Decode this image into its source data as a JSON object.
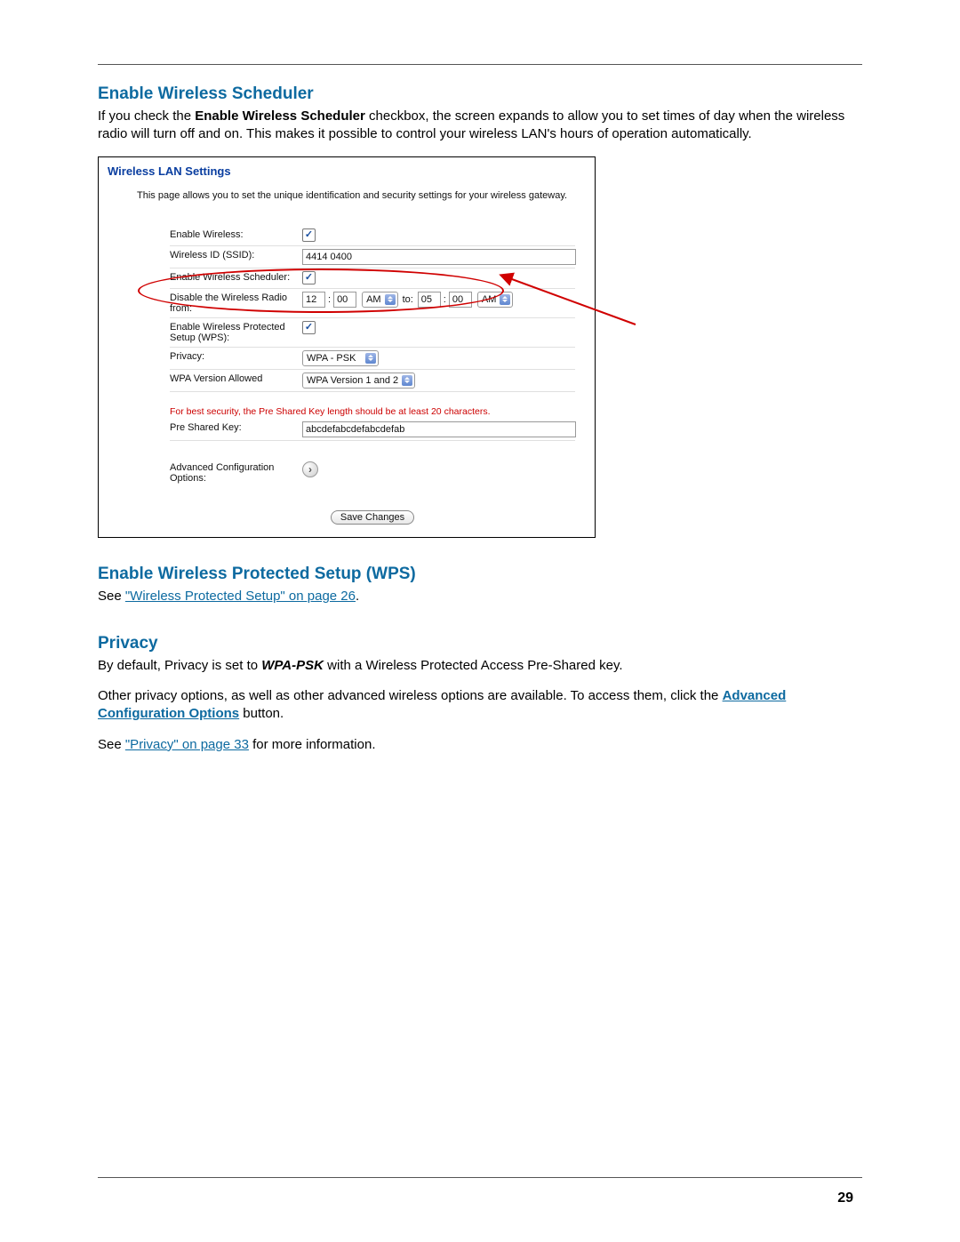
{
  "page_number": "29",
  "sections": {
    "scheduler": {
      "heading": "Enable Wireless Scheduler",
      "body_pre": "If you check the ",
      "body_bold": "Enable Wireless Scheduler",
      "body_post": " checkbox, the screen expands to allow you to set times of day when the wireless radio will turn off and on. This makes it possible to control your wireless LAN's hours of operation automatically."
    },
    "wps": {
      "heading": "Enable Wireless Protected Setup (WPS)",
      "see": "See ",
      "link": "\"Wireless Protected Setup\" on page 26",
      "tail": "."
    },
    "privacy": {
      "heading": "Privacy",
      "p1_pre": "By default, Privacy is set to ",
      "p1_bold": "WPA-PSK",
      "p1_post": " with a Wireless Protected Access Pre-Shared key.",
      "p2_pre": "Other privacy options, as well as other advanced wireless options are available. To access them, click the ",
      "p2_link": "Advanced Configuration Options",
      "p2_post": " button.",
      "p3_pre": "See ",
      "p3_link": "\"Privacy\" on page 33",
      "p3_post": " for more information."
    }
  },
  "panel": {
    "title": "Wireless LAN Settings",
    "desc": "This page allows you to set the unique identification and security settings for your wireless gateway.",
    "labels": {
      "enable_wireless": "Enable Wireless:",
      "ssid": "Wireless ID (SSID):",
      "enable_scheduler": "Enable Wireless Scheduler:",
      "disable_radio": "Disable the Wireless Radio from:",
      "wps": "Enable Wireless Protected Setup (WPS):",
      "privacy": "Privacy:",
      "wpa_version": "WPA Version Allowed",
      "psk": "Pre Shared Key:",
      "adv": "Advanced Configuration Options:"
    },
    "values": {
      "ssid": "4414 0400",
      "from_hour": "12",
      "from_min": "00",
      "from_ampm": "AM",
      "to_word": "to:",
      "to_hour": "05",
      "to_min": "00",
      "to_ampm": "AM",
      "privacy_sel": "WPA - PSK",
      "wpa_version_sel": "WPA Version 1 and 2",
      "psk": "abcdefabcdefabcdefab"
    },
    "note": "For best security, the Pre Shared Key length should be at least 20 characters.",
    "save": "Save Changes"
  }
}
